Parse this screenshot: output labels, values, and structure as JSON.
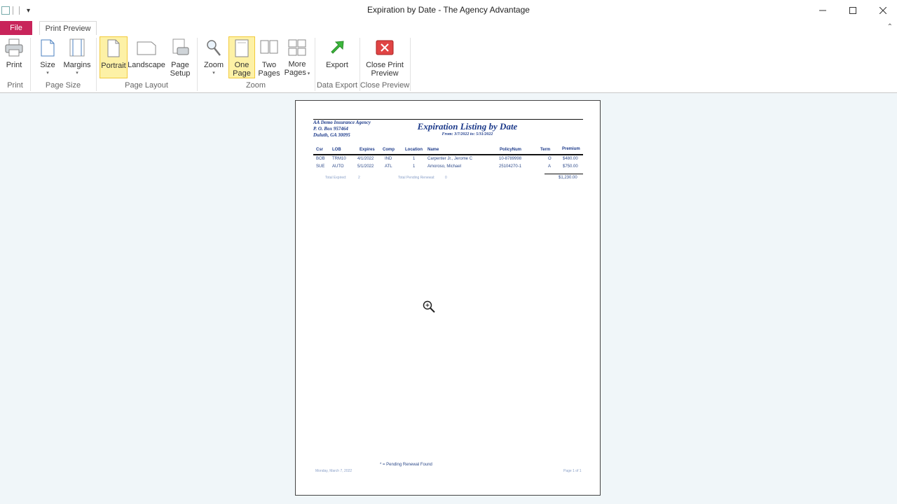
{
  "window": {
    "title": "Expiration by Date  -  The Agency Advantage",
    "minimize_glyph": "—",
    "maximize_glyph": "☐",
    "close_glyph": "✕"
  },
  "tabs": {
    "file": "File",
    "print_preview": "Print Preview"
  },
  "ribbon": {
    "print": "Print",
    "size": "Size",
    "margins": "Margins",
    "portrait": "Portrait",
    "landscape": "Landscape",
    "page_setup_1": "Page",
    "page_setup_2": "Setup",
    "zoom": "Zoom",
    "one_page_1": "One",
    "one_page_2": "Page",
    "two_pages_1": "Two",
    "two_pages_2": "Pages",
    "more_pages_1": "More",
    "more_pages_2": "Pages",
    "export": "Export",
    "close_preview_1": "Close Print",
    "close_preview_2": "Preview",
    "groups": {
      "print": "Print",
      "page_size": "Page Size",
      "page_layout": "Page Layout",
      "zoom": "Zoom",
      "data_export": "Data Export",
      "close_preview": "Close Preview"
    }
  },
  "report": {
    "agency_name": "AA Demo Insurance Agency",
    "agency_addr1": "P. O. Box 957464",
    "agency_addr2": "Duluth, GA  30095",
    "title": "Expiration Listing by Date",
    "subtitle": "From:  3/7/2022  to:  5/31/2022",
    "columns": [
      "Csr",
      "LOB",
      "Expires",
      "Comp",
      "Location",
      "Name",
      "PolicyNum",
      "Term",
      "Premium"
    ],
    "rows": [
      [
        "BOB",
        "TRM10",
        "4/1/2022",
        "IND",
        "1",
        "Carpenter Jr., Jerome C",
        "10-8789998",
        "O",
        "$480.00"
      ],
      [
        "SUE",
        "AUTO",
        "5/1/2022",
        "ATL",
        "1",
        "Amoroso, Michael",
        "25104270-1",
        "A",
        "$750.00"
      ]
    ],
    "total_expired_label": "Total Expired:",
    "total_expired_value": "2",
    "total_pending_label": "Total Pending Renewal:",
    "total_pending_value": "0",
    "total_premium": "$1,230.00",
    "footnote": "* = Pending Renewal Found",
    "footer_date": "Monday, March 7, 2022",
    "footer_page": "Page 1 of 1"
  },
  "colors": {
    "file_tab": "#c8245a",
    "selected": "#fdf1a6",
    "report_text": "#1c3a8a"
  }
}
